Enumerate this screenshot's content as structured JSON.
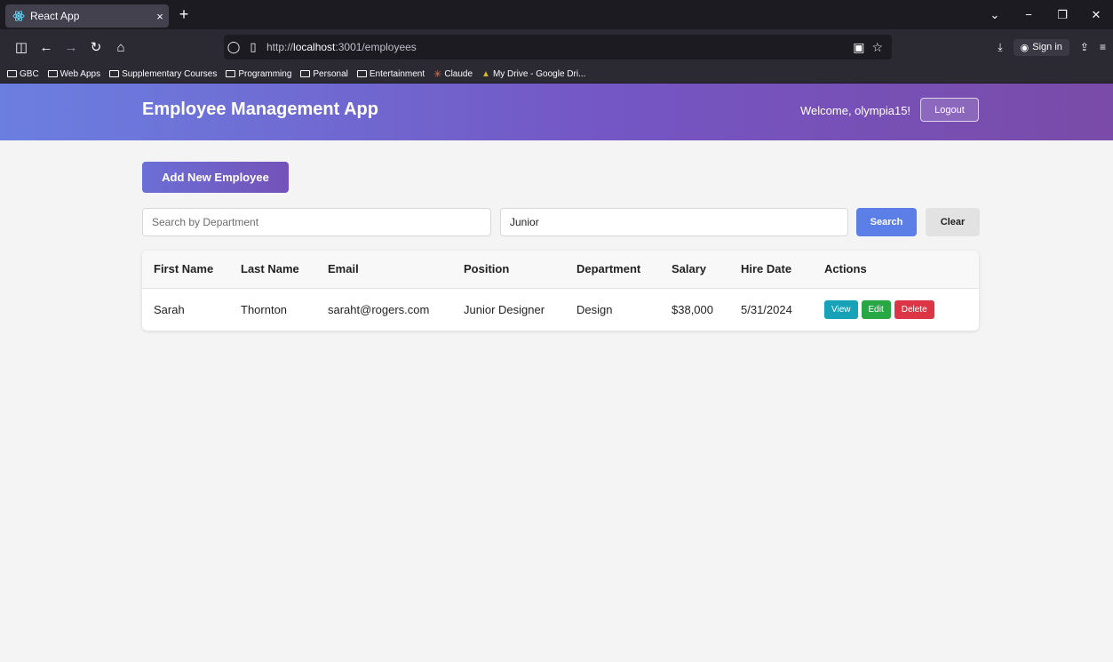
{
  "browser": {
    "tab_title": "React App",
    "tab_close": "×",
    "new_tab": "+",
    "url_prefix": "http://",
    "url_host": "localhost",
    "url_rest": ":3001/employees",
    "sign_in": "Sign in",
    "bookmarks": [
      {
        "label": "GBC",
        "icon": "folder-icon"
      },
      {
        "label": "Web Apps",
        "icon": "folder-icon"
      },
      {
        "label": "Supplementary Courses",
        "icon": "folder-icon"
      },
      {
        "label": "Programming",
        "icon": "folder-icon"
      },
      {
        "label": "Personal",
        "icon": "folder-icon"
      },
      {
        "label": "Entertainment",
        "icon": "folder-icon"
      },
      {
        "label": "Claude",
        "icon": "claude-icon"
      },
      {
        "label": "My Drive - Google Dri...",
        "icon": "google-drive-icon"
      }
    ]
  },
  "header": {
    "title": "Employee Management App",
    "welcome": "Welcome, olympia15!",
    "logout_label": "Logout"
  },
  "toolbar": {
    "add_label": "Add New Employee"
  },
  "search": {
    "department_placeholder": "Search by Department",
    "department_value": "",
    "position_value": "Junior",
    "search_label": "Search",
    "clear_label": "Clear"
  },
  "table": {
    "columns": [
      "First Name",
      "Last Name",
      "Email",
      "Position",
      "Department",
      "Salary",
      "Hire Date",
      "Actions"
    ],
    "rows": [
      {
        "first_name": "Sarah",
        "last_name": "Thornton",
        "email": "saraht@rogers.com",
        "position": "Junior Designer",
        "department": "Design",
        "salary": "$38,000",
        "hire_date": "5/31/2024",
        "view_label": "View",
        "edit_label": "Edit",
        "delete_label": "Delete"
      }
    ]
  },
  "colors": {
    "header_gradient_start": "#6b7fe0",
    "header_gradient_end": "#7a4ba8",
    "search_button": "#5b7fe6",
    "view_button": "#17a2b8",
    "edit_button": "#28a745",
    "delete_button": "#dc3545"
  }
}
